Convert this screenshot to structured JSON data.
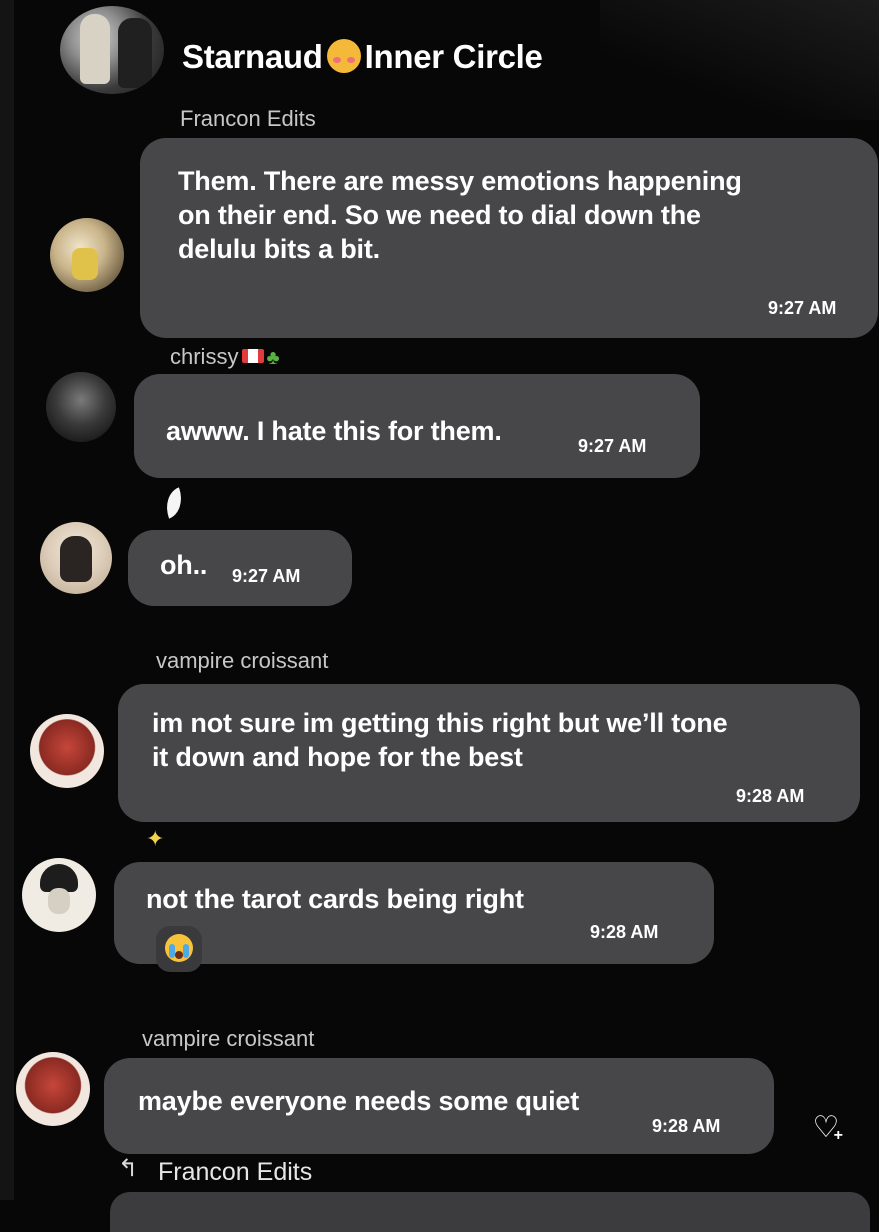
{
  "header": {
    "title_part1": "Starnaud",
    "title_emoji": "smiling-face-with-hearts-icon",
    "title_part2": "Inner Circle"
  },
  "messages": [
    {
      "sender": "Francon Edits",
      "text": "Them. There are messy emotions happening\non their end. So we need to dial down the\ndelulu bits a bit.",
      "time": "9:27 AM"
    },
    {
      "sender": "chrissy",
      "sender_emojis": [
        "canada-flag-icon",
        "palm-tree-icon"
      ],
      "text": "awww. I hate this for them.",
      "time": "9:27 AM"
    },
    {
      "sender_icon": "leaf-icon",
      "text": "oh..",
      "time": "9:27 AM"
    },
    {
      "sender": "vampire croissant",
      "text": "im not sure im getting this right but we’ll tone\nit down and hope for the best",
      "time": "9:28 AM"
    },
    {
      "sender_icon": "sparkles-icon",
      "text": "not the tarot cards being right",
      "time": "9:28 AM",
      "reaction": "loudly-crying-face-icon"
    },
    {
      "sender": "vampire croissant",
      "text": "maybe everyone needs some quiet",
      "time": "9:28 AM",
      "action_icon": "heart-add-icon"
    }
  ],
  "reply_preview": {
    "icon": "reply-arrow-icon",
    "name": "Francon Edits"
  },
  "colors": {
    "background": "#070707",
    "bubble": "#47474a",
    "text": "#ffffff",
    "sender": "#c7c7c7"
  }
}
